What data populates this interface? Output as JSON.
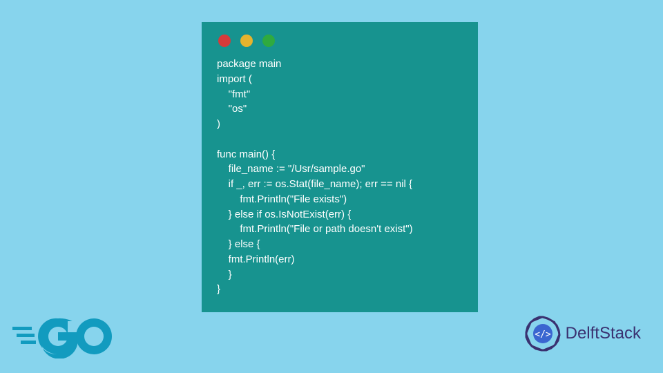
{
  "colors": {
    "bg": "#87d4ed",
    "card": "#17938f",
    "text": "#ffffff",
    "dot_red": "#d63a3a",
    "dot_yellow": "#e6b32d",
    "dot_green": "#2faa3f",
    "go_blue": "#129bbf",
    "delft_purple": "#3a3170"
  },
  "window_dots": [
    "red",
    "yellow",
    "green"
  ],
  "code": "package main\nimport (\n    \"fmt\"\n    \"os\"\n)\n\nfunc main() {\n    file_name := \"/Usr/sample.go\"\n    if _, err := os.Stat(file_name); err == nil {\n        fmt.Println(\"File exists\")\n    } else if os.IsNotExist(err) {\n        fmt.Println(\"File or path doesn't exist\")\n    } else {\n    fmt.Println(err)\n    }\n}",
  "go_logo_text": "GO",
  "delft_label": "DelftStack",
  "delft_badge_text": "</>"
}
